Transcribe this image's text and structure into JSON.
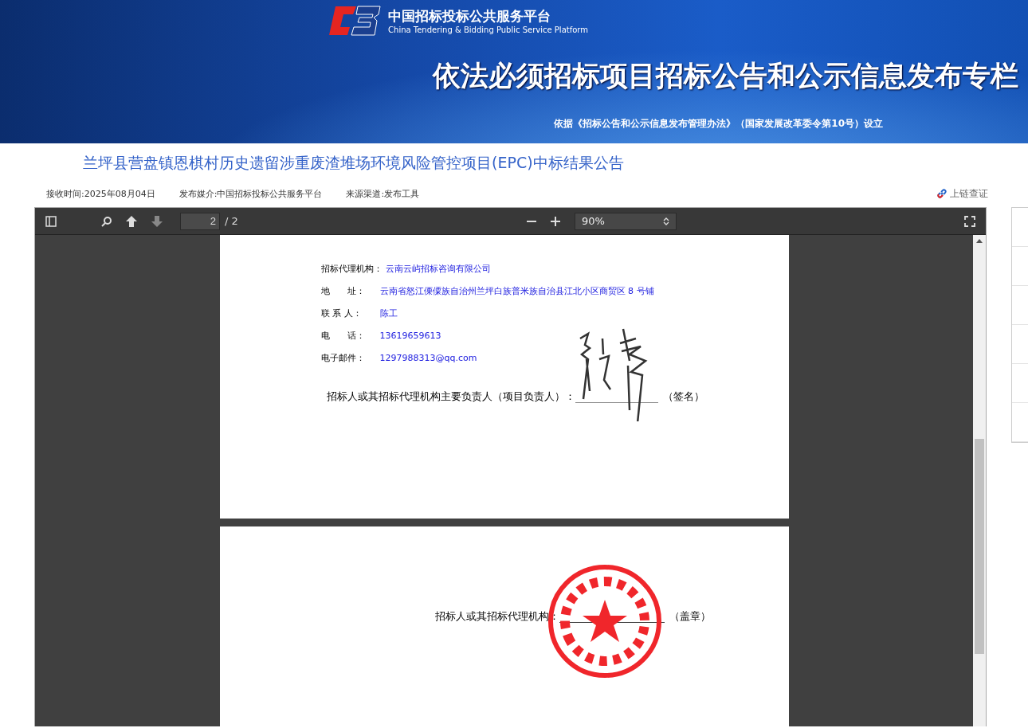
{
  "header": {
    "site_name": "中国招标投标公共服务平台",
    "site_name_en": "China Tendering & Bidding Public Service Platform",
    "banner_title": "依法必须招标项目招标公告和公示信息发布专栏",
    "banner_note": "依据《招标公告和公示信息发布管理办法》（国家发展改革委令第10号）设立"
  },
  "notice": {
    "title": "兰坪县营盘镇恩棋村历史遗留涉重废渣堆场环境风险管控项目(EPC)中标结果公告",
    "meta": [
      "接收时间:2025年08月04日",
      "发布媒介:中国招标投标公共服务平台",
      "来源渠道:发布工具"
    ],
    "chain_link": "上链查证"
  },
  "viewer": {
    "page_input": "2",
    "page_total": "/ 2",
    "zoom": "90%"
  },
  "pages": [
    {
      "fields": [
        {
          "label": "招标代理机构：",
          "value": "云南云屿招标咨询有限公司"
        },
        {
          "label": "地　　址：",
          "value": "云南省怒江傈僳族自治州兰坪白族普米族自治县江北小区商贸区 8 号铺"
        },
        {
          "label": "联 系 人：",
          "value": "陈工"
        },
        {
          "label": "电　　话：",
          "value": "13619659613"
        },
        {
          "label": "电子邮件：",
          "value": "1297988313@qq.com"
        }
      ],
      "sign": {
        "kind": "signature",
        "label": "招标人或其招标代理机构主要负责人（项目负责人）：",
        "suffix": "（签名）"
      }
    },
    {
      "sign": {
        "kind": "seal",
        "label": "招标人或其招标代理机构：",
        "suffix": "（盖章）"
      }
    }
  ]
}
